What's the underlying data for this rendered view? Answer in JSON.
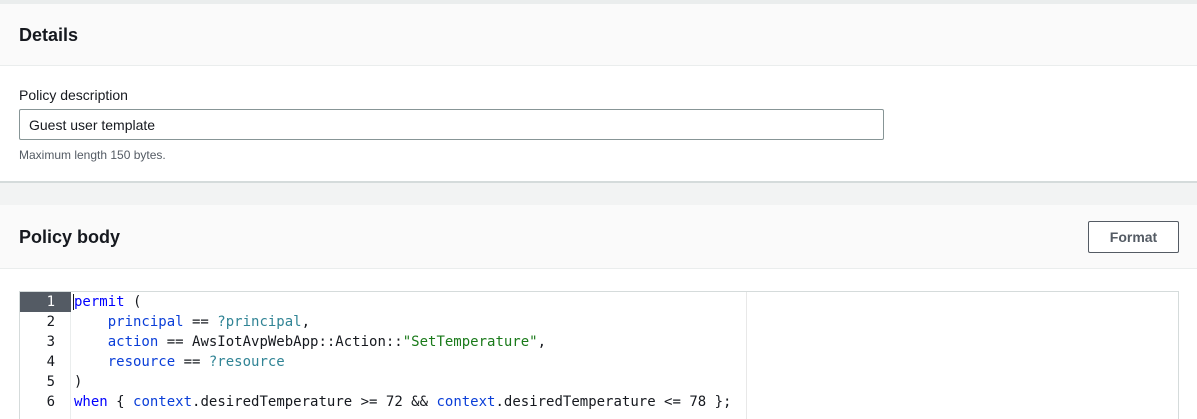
{
  "details": {
    "title": "Details",
    "description_label": "Policy description",
    "description_value": "Guest user template",
    "description_hint": "Maximum length 150 bytes."
  },
  "policy_body": {
    "title": "Policy body",
    "format_button": "Format",
    "active_line": 1,
    "lines": [
      {
        "num": "1",
        "tokens": [
          {
            "t": "permit",
            "c": "kw"
          },
          {
            "t": " (",
            "c": ""
          }
        ]
      },
      {
        "num": "2",
        "tokens": [
          {
            "t": "    ",
            "c": ""
          },
          {
            "t": "principal",
            "c": "var"
          },
          {
            "t": " == ",
            "c": ""
          },
          {
            "t": "?principal",
            "c": "slot"
          },
          {
            "t": ",",
            "c": ""
          }
        ]
      },
      {
        "num": "3",
        "tokens": [
          {
            "t": "    ",
            "c": ""
          },
          {
            "t": "action",
            "c": "var"
          },
          {
            "t": " == AwsIotAvpWebApp::Action::",
            "c": ""
          },
          {
            "t": "\"SetTemperature\"",
            "c": "str"
          },
          {
            "t": ",",
            "c": ""
          }
        ]
      },
      {
        "num": "4",
        "tokens": [
          {
            "t": "    ",
            "c": ""
          },
          {
            "t": "resource",
            "c": "var"
          },
          {
            "t": " == ",
            "c": ""
          },
          {
            "t": "?resource",
            "c": "slot"
          }
        ]
      },
      {
        "num": "5",
        "tokens": [
          {
            "t": ")",
            "c": ""
          }
        ]
      },
      {
        "num": "6",
        "tokens": [
          {
            "t": "when",
            "c": "kw"
          },
          {
            "t": " { ",
            "c": ""
          },
          {
            "t": "context",
            "c": "var"
          },
          {
            "t": ".desiredTemperature >= 72 && ",
            "c": ""
          },
          {
            "t": "context",
            "c": "var"
          },
          {
            "t": ".desiredTemperature <= 78 };",
            "c": ""
          }
        ]
      }
    ]
  }
}
